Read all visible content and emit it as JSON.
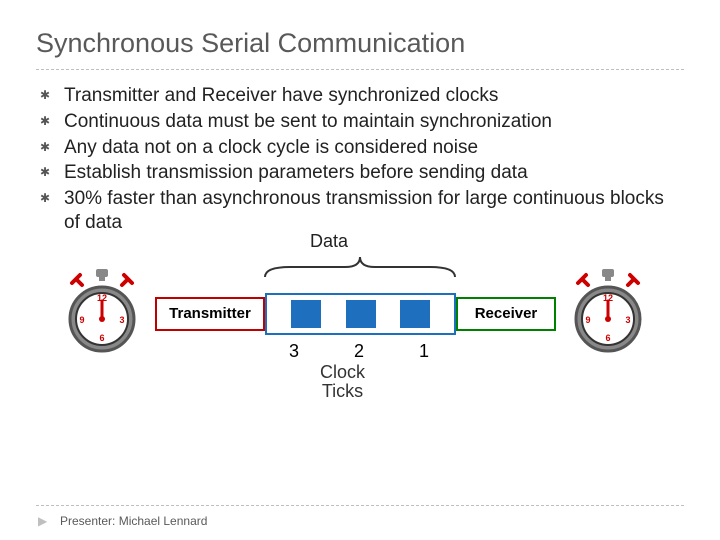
{
  "title": "Synchronous Serial Communication",
  "bullets": [
    "Transmitter and Receiver have synchronized  clocks",
    "Continuous data must be sent to maintain synchronization",
    "Any data not on a clock cycle is considered noise",
    "Establish transmission parameters before sending data",
    "30% faster than asynchronous transmission for large continuous blocks of data"
  ],
  "diagram": {
    "data_label": "Data",
    "transmitter": "Transmitter",
    "receiver": "Receiver",
    "ticks": [
      "3",
      "2",
      "1"
    ],
    "clock_label_line1": "Clock",
    "clock_label_line2": "Ticks"
  },
  "footer": "Presenter: Michael Lennard"
}
